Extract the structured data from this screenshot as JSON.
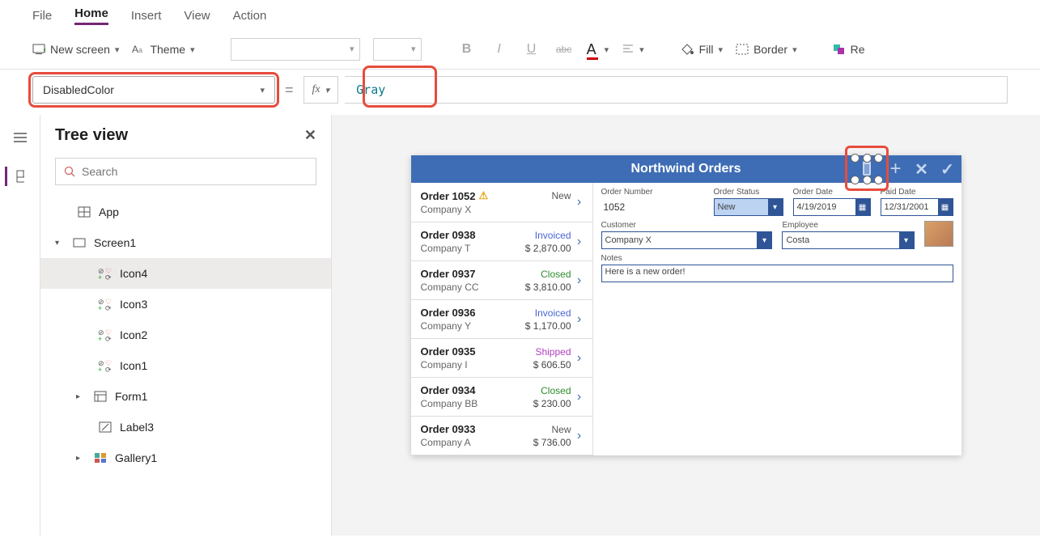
{
  "menu": {
    "file": "File",
    "home": "Home",
    "insert": "Insert",
    "view": "View",
    "action": "Action"
  },
  "toolbar": {
    "new_screen": "New screen",
    "theme": "Theme",
    "fill": "Fill",
    "border": "Border",
    "reorder": "Re"
  },
  "formula": {
    "property": "DisabledColor",
    "fx": "fx",
    "value": "Gray"
  },
  "panel": {
    "title": "Tree view",
    "search_placeholder": "Search",
    "app": "App",
    "screen": "Screen1",
    "nodes": {
      "icon4": "Icon4",
      "icon3": "Icon3",
      "icon2": "Icon2",
      "icon1": "Icon1",
      "form1": "Form1",
      "label3": "Label3",
      "gallery1": "Gallery1"
    }
  },
  "app": {
    "title": "Northwind Orders",
    "orders": [
      {
        "num": "Order 1052",
        "company": "Company X",
        "status": "New",
        "statusClass": "st-new",
        "amount": "",
        "warn": true
      },
      {
        "num": "Order 0938",
        "company": "Company T",
        "status": "Invoiced",
        "statusClass": "st-invoiced",
        "amount": "$ 2,870.00"
      },
      {
        "num": "Order 0937",
        "company": "Company CC",
        "status": "Closed",
        "statusClass": "st-closed",
        "amount": "$ 3,810.00"
      },
      {
        "num": "Order 0936",
        "company": "Company Y",
        "status": "Invoiced",
        "statusClass": "st-invoiced",
        "amount": "$ 1,170.00"
      },
      {
        "num": "Order 0935",
        "company": "Company I",
        "status": "Shipped",
        "statusClass": "st-shipped",
        "amount": "$ 606.50"
      },
      {
        "num": "Order 0934",
        "company": "Company BB",
        "status": "Closed",
        "statusClass": "st-closed",
        "amount": "$ 230.00"
      },
      {
        "num": "Order 0933",
        "company": "Company A",
        "status": "New",
        "statusClass": "st-new",
        "amount": "$ 736.00"
      }
    ],
    "detail": {
      "orderNumber_label": "Order Number",
      "orderNumber": "1052",
      "orderStatus_label": "Order Status",
      "orderStatus": "New",
      "orderDate_label": "Order Date",
      "orderDate": "4/19/2019",
      "paidDate_label": "Paid Date",
      "paidDate": "12/31/2001",
      "customer_label": "Customer",
      "customer": "Company X",
      "employee_label": "Employee",
      "employee": "Costa",
      "notes_label": "Notes",
      "notes": "Here is a new order!"
    }
  }
}
